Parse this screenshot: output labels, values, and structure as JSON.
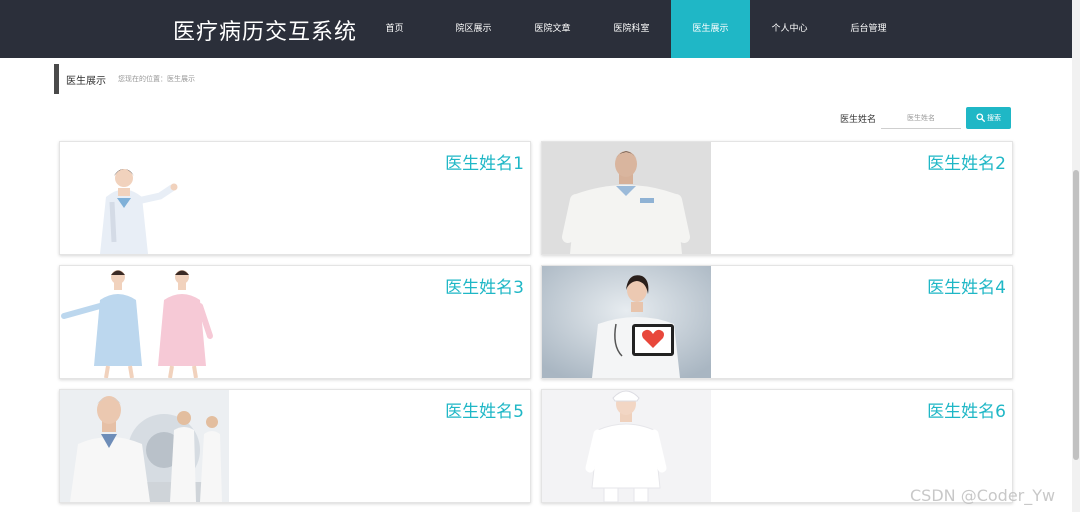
{
  "app": {
    "title": "医疗病历交互系统"
  },
  "nav": {
    "items": [
      {
        "label": "首页"
      },
      {
        "label": "院区展示"
      },
      {
        "label": "医院文章"
      },
      {
        "label": "医院科室"
      },
      {
        "label": "医生展示",
        "active": true
      },
      {
        "label": "个人中心"
      },
      {
        "label": "后台管理"
      }
    ],
    "active_color": "#1fb7c6",
    "bar_color": "#2b2f3a"
  },
  "breadcrumb": {
    "title": "医生展示",
    "location": "您现在的位置：医生展示"
  },
  "search": {
    "label": "医生姓名",
    "placeholder": "医生姓名",
    "value": "",
    "button_label": "搜索",
    "button_icon": "search-icon"
  },
  "doctors": [
    {
      "name": "医生姓名1",
      "photo": "female-doctor-presenting"
    },
    {
      "name": "医生姓名2",
      "photo": "male-doctor-white-coat"
    },
    {
      "name": "医生姓名3",
      "photo": "two-nurses"
    },
    {
      "name": "医生姓名4",
      "photo": "doctor-holding-heart-tablet"
    },
    {
      "name": "医生姓名5",
      "photo": "senior-doctor-with-scanner"
    },
    {
      "name": "医生姓名6",
      "photo": "nurse-in-white-uniform"
    }
  ],
  "watermark": "CSDN @Coder_Yw"
}
